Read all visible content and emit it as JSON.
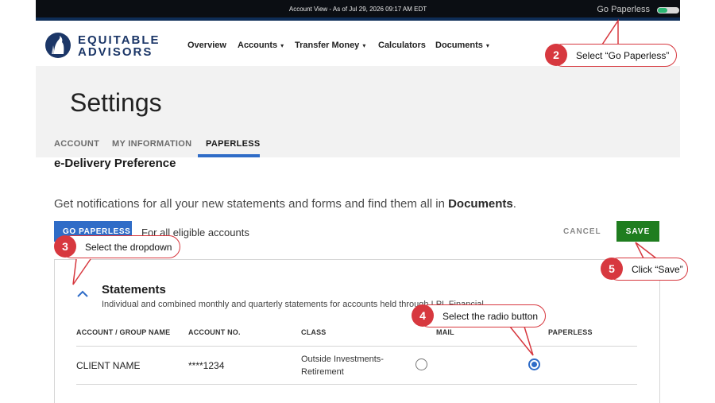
{
  "topbar": {
    "account_view": "Account View - As of Jul 29, 2026 09:17 AM EDT",
    "go_paperless": "Go Paperless"
  },
  "brand": {
    "line1": "EQUITABLE",
    "line2": "ADVISORS"
  },
  "nav": {
    "overview": "Overview",
    "accounts": "Accounts",
    "transfer": "Transfer Money",
    "calculators": "Calculators",
    "documents": "Documents"
  },
  "page": {
    "title": "Settings"
  },
  "tabs": [
    "ACCOUNT",
    "MY INFORMATION",
    "PAPERLESS"
  ],
  "edelivery": {
    "heading": "e-Delivery Preference",
    "notify_prefix": "Get notifications for all your new statements and forms and find them all in ",
    "notify_bold": "Documents",
    "notify_suffix": ".",
    "go_paperless_btn": "GO PAPERLESS",
    "all_eligible": "For all eligible accounts",
    "cancel": "CANCEL",
    "save": "SAVE"
  },
  "statements": {
    "title": "Statements",
    "desc": "Individual and combined monthly and quarterly statements for accounts held through LPL Financial."
  },
  "table": {
    "headers": [
      "ACCOUNT / GROUP NAME",
      "ACCOUNT NO.",
      "CLASS",
      "MAIL",
      "PAPERLESS"
    ],
    "rows": [
      {
        "name": "CLIENT NAME",
        "acct": "****1234",
        "class_l1": "Outside Investments-",
        "class_l2": "Retirement",
        "selected": "paperless"
      }
    ]
  },
  "callouts": {
    "c2": {
      "num": "2",
      "label": "Select “Go Paperless”"
    },
    "c3": {
      "num": "3",
      "label": "Select the dropdown"
    },
    "c4": {
      "num": "4",
      "label": "Select the radio button"
    },
    "c5": {
      "num": "5",
      "label": "Click “Save”"
    }
  },
  "colors": {
    "navy": "#1b3667",
    "accent_blue": "#2f6cc7",
    "save_green": "#1f7d1f",
    "callout_red": "#d7383f"
  }
}
